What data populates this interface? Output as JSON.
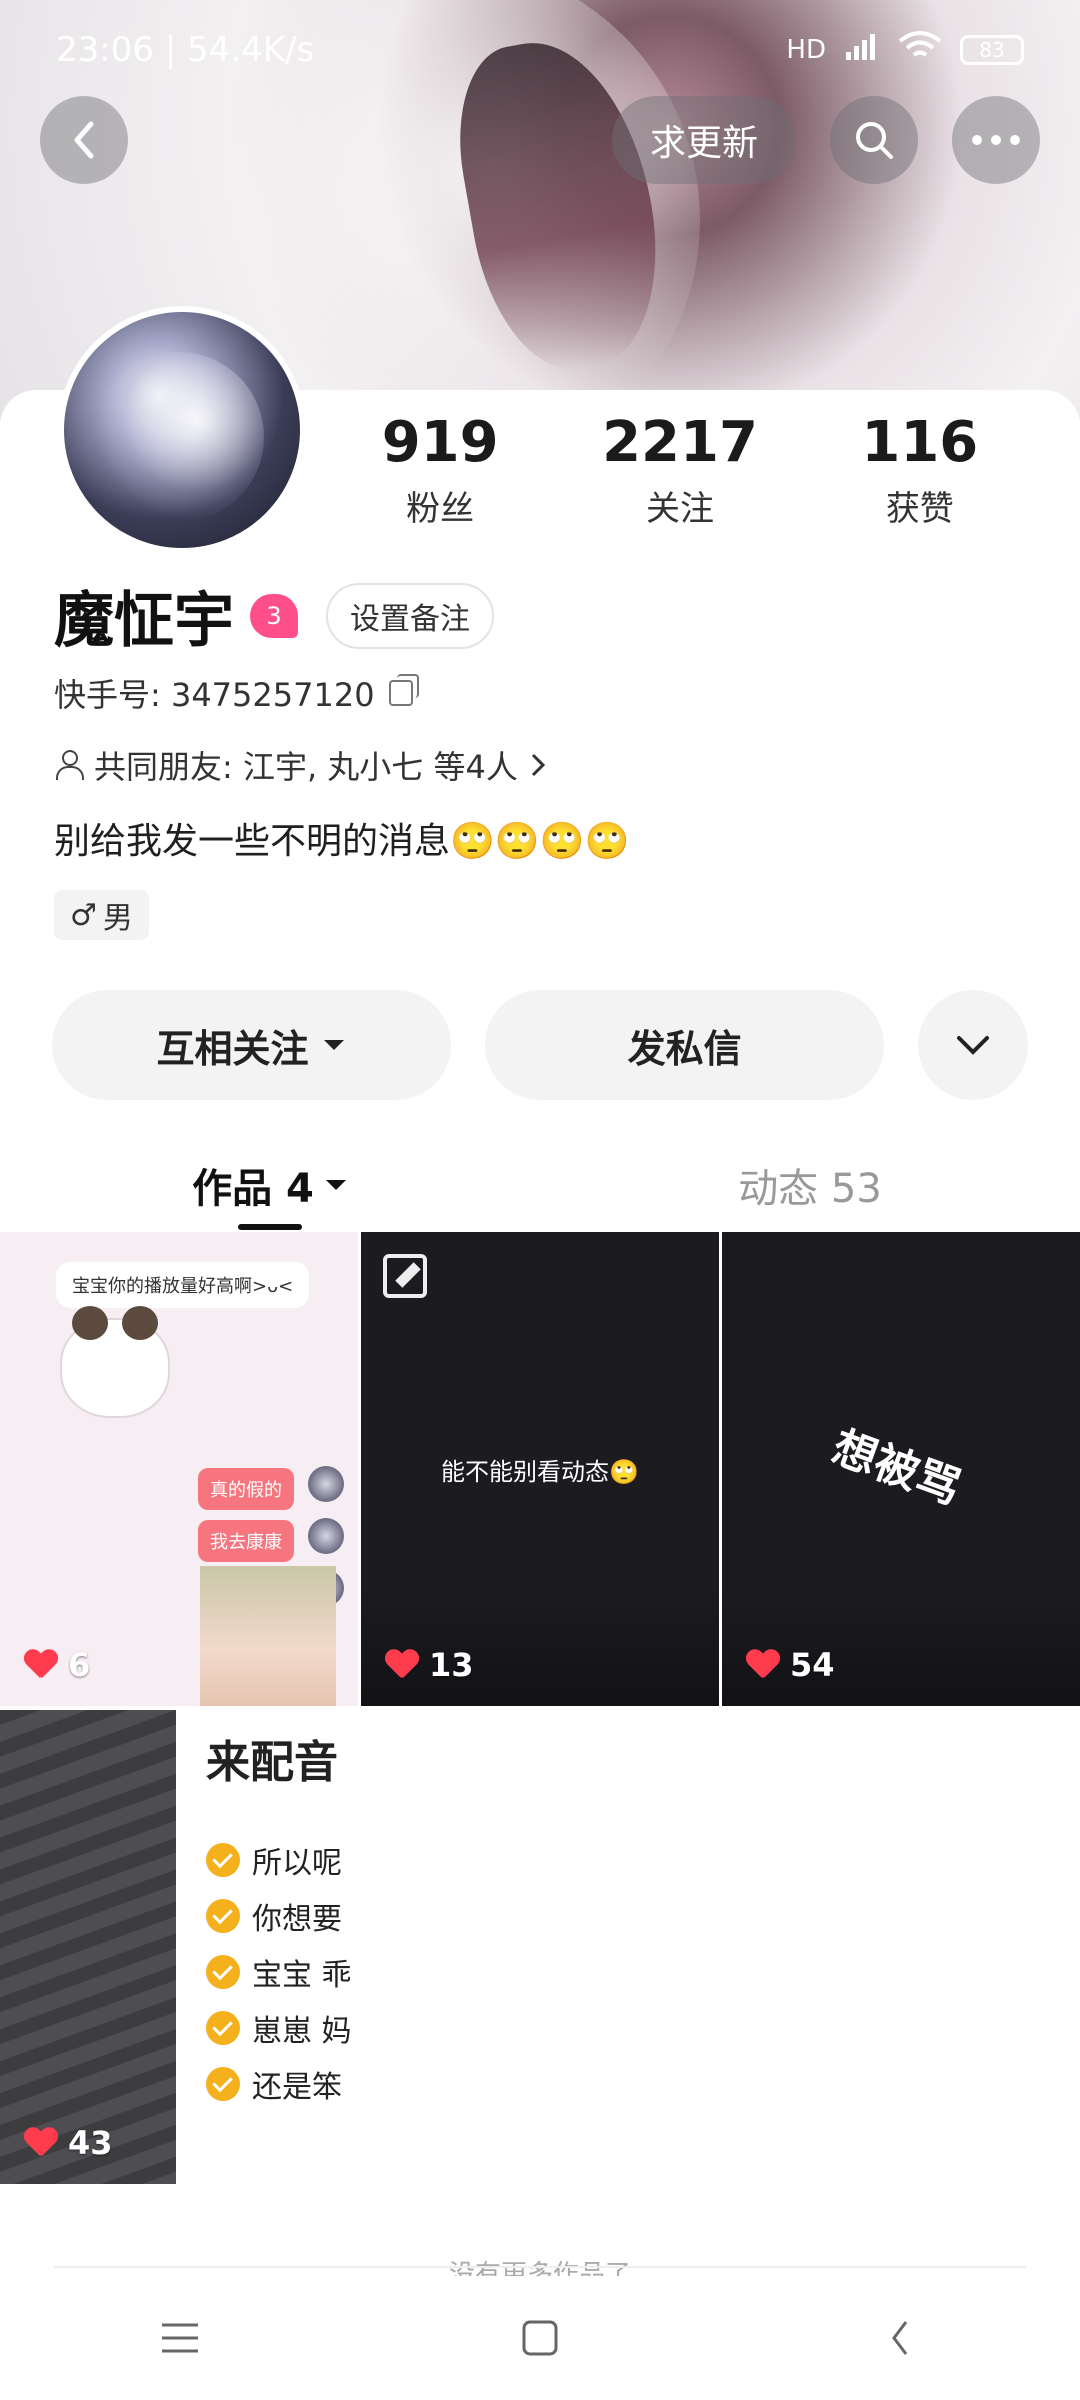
{
  "status": {
    "time": "23:06",
    "speed": "54.4K/s",
    "time_speed": "23:06 | 54.4K/s",
    "signal": "HD",
    "battery": "83"
  },
  "header": {
    "request_update_label": "求更新"
  },
  "profile": {
    "name": "魔怔宇",
    "level": "3",
    "remark_button": "设置备注",
    "kuaishou_id_label": "快手号: 3475257120",
    "mutual_friends": "共同朋友: 江宇, 丸小七 等4人",
    "bio": "别给我发一些不明的消息🙄🙄🙄🙄",
    "gender": "男"
  },
  "stats": [
    {
      "value": "919",
      "label": "粉丝"
    },
    {
      "value": "2217",
      "label": "关注"
    },
    {
      "value": "116",
      "label": "获赞"
    }
  ],
  "actions": {
    "follow_label": "互相关注",
    "message_label": "发私信"
  },
  "tabs": [
    {
      "label": "作品 4"
    },
    {
      "label": "动态 53"
    }
  ],
  "works": [
    {
      "likes": "6",
      "bubble": "宝宝你的播放量好高啊>ᴗ<",
      "reply1": "真的假的",
      "reply2": "我去康康"
    },
    {
      "likes": "13",
      "text": "能不能别看动态🙄"
    },
    {
      "likes": "54",
      "text": "想被骂"
    },
    {
      "likes": "43",
      "title": "来配音",
      "items": [
        "所以呢",
        "你想要",
        "宝宝 乖",
        "崽崽 妈",
        "还是笨"
      ]
    }
  ],
  "footer": {
    "end_text": "没有更多作品了"
  }
}
